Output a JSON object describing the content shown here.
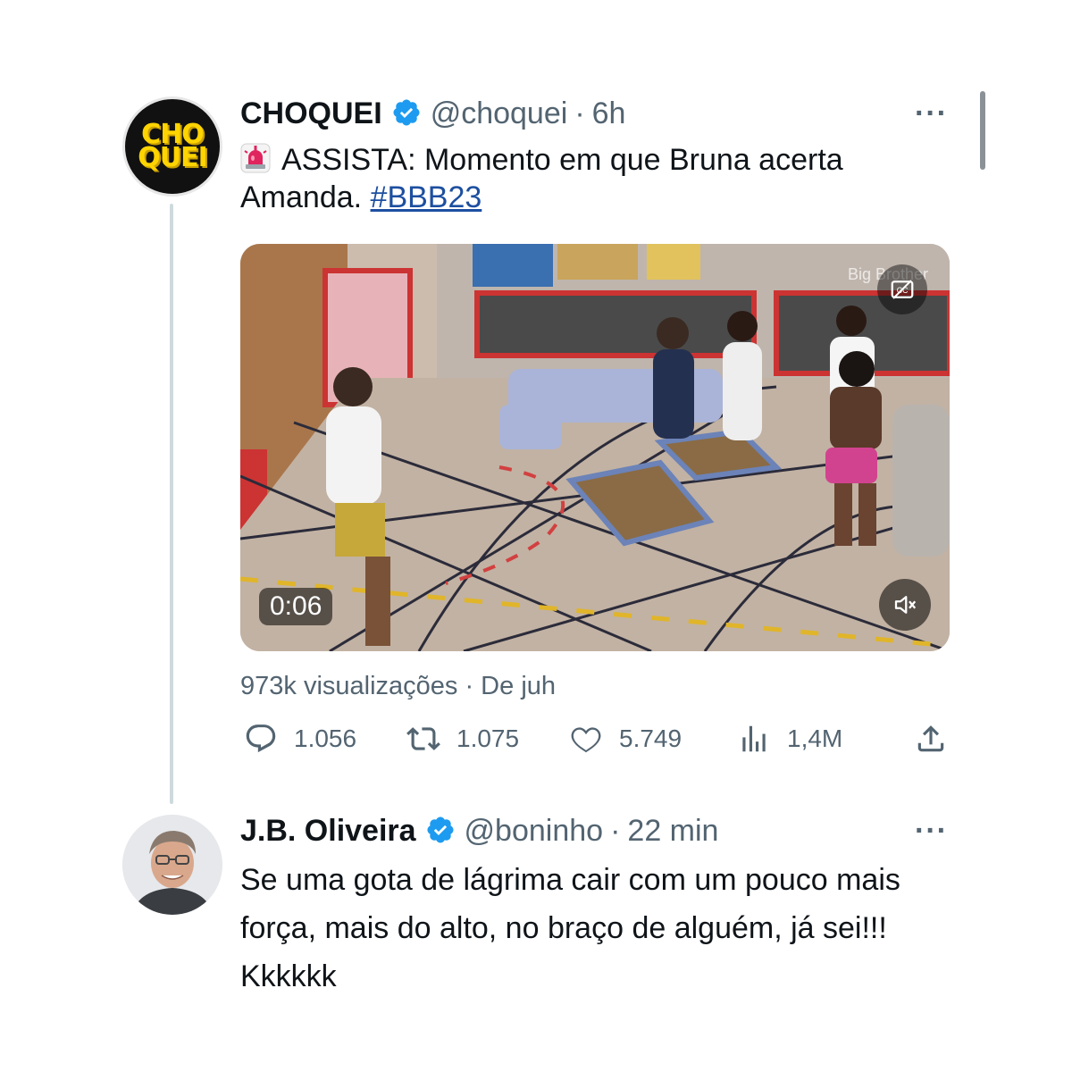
{
  "main_tweet": {
    "avatar_text_line1": "CHO",
    "avatar_text_line2": "QUEI",
    "display_name": "CHOQUEI",
    "handle": "@choquei",
    "separator": "·",
    "time": "6h",
    "more": "···",
    "text_part1": "ASSISTA: Momento em que Bruna acerta Amanda.",
    "hashtag": "#BBB23",
    "video": {
      "duration": "0:06",
      "watermark": "Big Brother"
    },
    "views_line": "973k visualizações · De juh",
    "stats": {
      "replies": "1.056",
      "retweets": "1.075",
      "likes": "5.749",
      "views": "1,4M"
    }
  },
  "reply_tweet": {
    "display_name": "J.B. Oliveira",
    "handle": "@boninho",
    "separator": "·",
    "time": "22 min",
    "more": "···",
    "text": "Se uma gota de lágrima cair com um pouco mais força, mais do alto,  no braço de alguém, já sei!!! Kkkkkk"
  },
  "colors": {
    "verified": "#1d9bf0",
    "secondary_text": "#536471",
    "hashtag": "#1d4fa0",
    "thread_line": "#cfd9de"
  },
  "icons": [
    "siren-icon",
    "verified-icon",
    "more-icon",
    "reply-icon",
    "retweet-icon",
    "like-icon",
    "views-icon",
    "share-icon",
    "mute-icon",
    "captions-icon"
  ]
}
